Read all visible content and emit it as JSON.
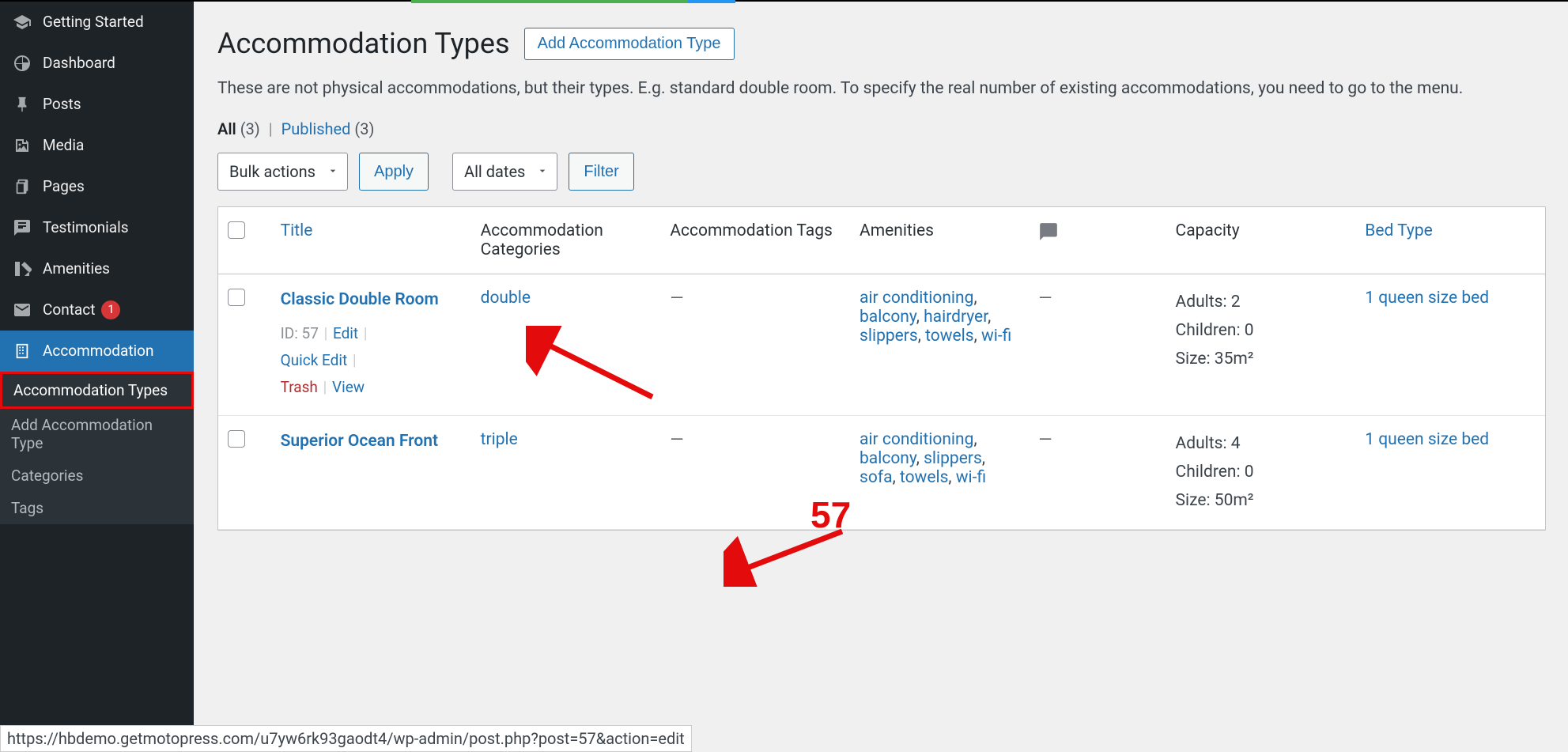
{
  "sidebar": {
    "items": [
      {
        "label": "Getting Started",
        "icon": "graduation-cap-icon"
      },
      {
        "label": "Dashboard",
        "icon": "dashboard-icon"
      },
      {
        "label": "Posts",
        "icon": "pin-icon"
      },
      {
        "label": "Media",
        "icon": "media-icon"
      },
      {
        "label": "Pages",
        "icon": "pages-icon"
      },
      {
        "label": "Testimonials",
        "icon": "chat-icon"
      },
      {
        "label": "Amenities",
        "icon": "swatch-icon"
      },
      {
        "label": "Contact",
        "icon": "mail-icon",
        "badge": "1"
      },
      {
        "label": "Accommodation",
        "icon": "building-icon",
        "current": true
      }
    ],
    "submenu": [
      {
        "label": "Accommodation Types",
        "active": true,
        "highlighted": true
      },
      {
        "label": "Add Accommodation Type"
      },
      {
        "label": "Categories"
      },
      {
        "label": "Tags"
      }
    ]
  },
  "page": {
    "title": "Accommodation Types",
    "add_button": "Add Accommodation Type",
    "description": "These are not physical accommodations, but their types. E.g. standard double room. To specify the real number of existing accommodations, you need to go to the menu."
  },
  "filters": {
    "all_label": "All",
    "all_count": "(3)",
    "published_label": "Published",
    "published_count": "(3)"
  },
  "controls": {
    "bulk_actions": "Bulk actions",
    "apply": "Apply",
    "all_dates": "All dates",
    "filter": "Filter"
  },
  "table": {
    "columns": {
      "title": "Title",
      "categories": "Accommodation Categories",
      "tags": "Accommodation Tags",
      "amenities": "Amenities",
      "capacity": "Capacity",
      "bed_type": "Bed Type"
    },
    "rows": [
      {
        "title": "Classic Double Room",
        "id_label": "ID: 57",
        "edit": "Edit",
        "quick_edit": "Quick Edit",
        "trash": "Trash",
        "view": "View",
        "category": "double",
        "tags": "—",
        "amenities": [
          "air conditioning",
          "balcony",
          "hairdryer",
          "slippers",
          "towels",
          "wi-fi"
        ],
        "comments": "—",
        "capacity": {
          "adults": "Adults: 2",
          "children": "Children: 0",
          "size": "Size: 35m²"
        },
        "bed_type": "1 queen size bed"
      },
      {
        "title": "Superior Ocean Front",
        "category": "triple",
        "tags": "—",
        "amenities": [
          "air conditioning",
          "balcony",
          "slippers",
          "sofa",
          "towels",
          "wi-fi"
        ],
        "comments": "—",
        "capacity": {
          "adults": "Adults: 4",
          "children": "Children: 0",
          "size": "Size: 50m²"
        },
        "bed_type": "1 queen size bed"
      }
    ]
  },
  "annotations": {
    "number": "57"
  },
  "status_url": "https://hbdemo.getmotopress.com/u7yw6rk93gaodt4/wp-admin/post.php?post=57&action=edit"
}
